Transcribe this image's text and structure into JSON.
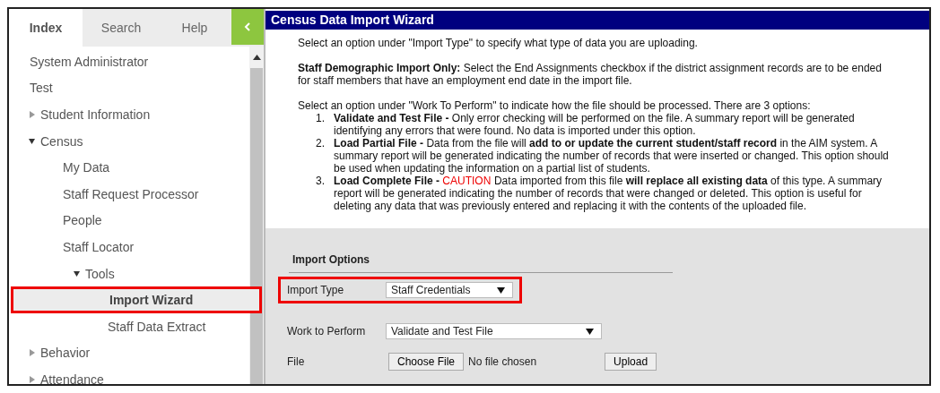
{
  "sidebar": {
    "tabs": [
      {
        "label": "Index",
        "selected": true
      },
      {
        "label": "Search",
        "selected": false
      },
      {
        "label": "Help",
        "selected": false
      }
    ],
    "tree": [
      {
        "label": "System Administrator",
        "selected": false,
        "highlighted": false
      },
      {
        "label": "Test",
        "selected": false,
        "highlighted": false
      },
      {
        "label": "Student Information",
        "expanded": false,
        "selected": false,
        "highlighted": false
      },
      {
        "label": "Census",
        "expanded": true,
        "selected": false,
        "highlighted": false,
        "children": [
          {
            "label": "My Data",
            "selected": false,
            "highlighted": false
          },
          {
            "label": "Staff Request Processor",
            "selected": false,
            "highlighted": false
          },
          {
            "label": "People",
            "selected": false,
            "highlighted": false
          },
          {
            "label": "Staff Locator",
            "selected": false,
            "highlighted": false
          },
          {
            "label": "Tools",
            "expanded": true,
            "selected": false,
            "highlighted": false,
            "children": [
              {
                "label": "Import Wizard",
                "selected": true,
                "highlighted": true
              },
              {
                "label": "Staff Data Extract",
                "selected": false,
                "highlighted": false
              }
            ]
          }
        ]
      },
      {
        "label": "Behavior",
        "expanded": false,
        "selected": false,
        "highlighted": false
      },
      {
        "label": "Attendance",
        "expanded": false,
        "selected": false,
        "highlighted": false
      }
    ]
  },
  "window": {
    "title": "Census Data Import Wizard"
  },
  "instructions": {
    "paragraphs": [
      "Select an option under \"Import Type\" to specify what type of data you are uploading.",
      "**Staff Demographic Import Only:** Select the End Assignments checkbox if the district assignment records are to be ended for staff members that have an employment end date in the import file.",
      "Select an option under \"Work To Perform\" to indicate how the file should be processed. There are 3 options:"
    ],
    "options": [
      {
        "number": "1.",
        "lead": "Validate and Test File -",
        "text": "Only error checking will be performed on the file. A summary report will be generated identifying any errors that were found. No data is imported under this option."
      },
      {
        "number": "2.",
        "lead": "Load Partial File -",
        "text": "Data from the file will **add to or update the current student/staff record** in the AIM system. A summary report will be generated indicating the number of records that were inserted or changed. This option should be used when updating the information on a partial list of students."
      },
      {
        "number": "3.",
        "lead": "Load Complete File -",
        "caution": "CAUTION",
        "text": "Data imported from this file **will replace all existing data** of this type. A summary report will be generated indicating the number of records that were changed or deleted. This option is useful for deleting any data that was previously entered and replacing it with the contents of the uploaded file."
      }
    ]
  },
  "import_options": {
    "heading": "Import Options",
    "import_type": {
      "label": "Import Type",
      "value": "Staff Credentials",
      "highlighted": true
    },
    "work_to_perform": {
      "label": "Work to Perform",
      "value": "Validate and Test File"
    },
    "file": {
      "label": "File",
      "choose_button": "Choose File",
      "status": "No file chosen",
      "upload_button": "Upload"
    }
  }
}
